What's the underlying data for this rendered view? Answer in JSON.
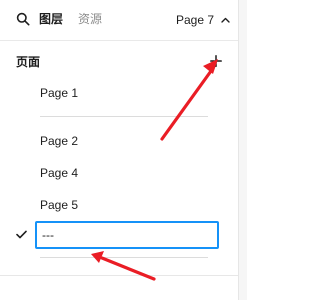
{
  "header": {
    "search_icon": "search-icon",
    "tabs": [
      {
        "label": "图层",
        "active": true
      },
      {
        "label": "资源",
        "active": false
      }
    ],
    "page_switcher": {
      "label": "Page 7",
      "icon": "chevron-up-icon"
    }
  },
  "pages_section": {
    "title": "页面",
    "add_icon": "plus-icon",
    "items": [
      {
        "label": "Page 1"
      },
      {
        "label": "Page 2"
      },
      {
        "label": "Page 4"
      },
      {
        "label": "Page 5"
      }
    ],
    "editing_item": {
      "value": "---",
      "selected": true,
      "check_icon": "checkmark-icon"
    }
  },
  "colors": {
    "accent": "#1592f8",
    "annotation": "#ea1d25",
    "text": "#1e1e1e",
    "muted_text": "#8c8c8c"
  }
}
